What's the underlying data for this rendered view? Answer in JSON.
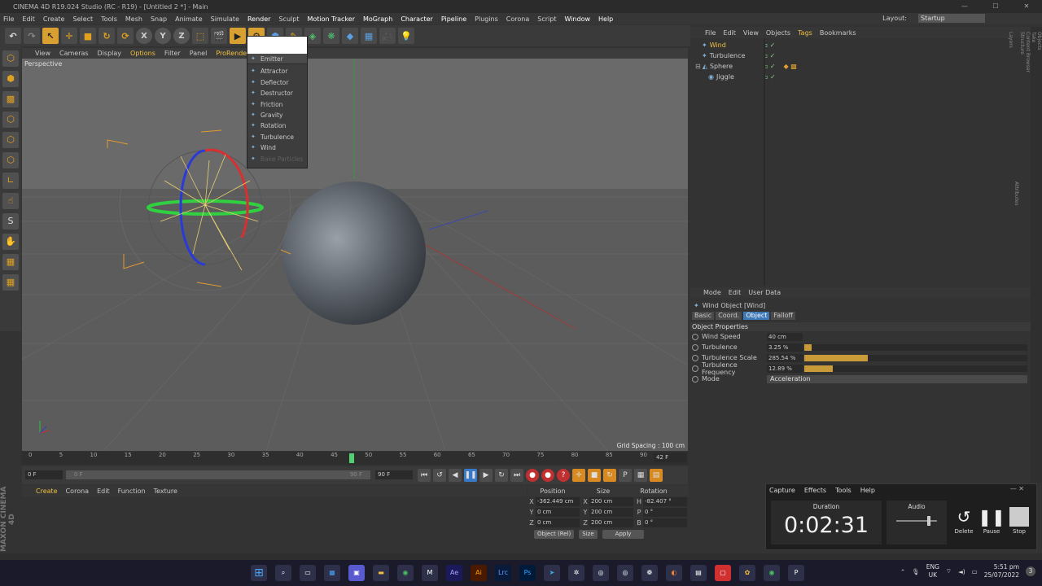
{
  "window": {
    "title": "CINEMA 4D R19.024 Studio (RC - R19) - [Untitled 2 *] - Main",
    "controls": [
      "—",
      "☐",
      "✕"
    ]
  },
  "menubar": {
    "items": [
      "File",
      "Edit",
      "Create",
      "Select",
      "Tools",
      "Mesh",
      "Snap",
      "Animate",
      "Simulate",
      "Render",
      "Sculpt",
      "Motion Tracker",
      "MoGraph",
      "Character",
      "Pipeline",
      "Plugins",
      "Corona",
      "Script",
      "Window",
      "Help"
    ],
    "highlighted": [
      "Render",
      "Motion Tracker",
      "MoGraph",
      "Character",
      "Pipeline",
      "Window",
      "Help"
    ],
    "layout_label": "Layout:",
    "layout_value": "Startup"
  },
  "toolbar": {
    "buttons": [
      "undo-icon",
      "redo-icon",
      "select-icon",
      "move-icon",
      "scale-icon",
      "rotate-icon",
      "live-select-icon",
      "x-axis",
      "y-axis",
      "z-axis",
      "coord-system-icon",
      "render-view-icon",
      "render-icon",
      "render-settings-icon",
      "cube-icon",
      "pen-icon",
      "subdivision-icon",
      "array-icon",
      "deformer-icon",
      "floor-icon",
      "camera-icon",
      "light-icon"
    ],
    "xyz": [
      "X",
      "Y",
      "Z"
    ]
  },
  "dropdown": {
    "items": [
      "Emitter",
      "Attractor",
      "Deflector",
      "Destructor",
      "Friction",
      "Gravity",
      "Rotation",
      "Turbulence",
      "Wind",
      "Bake Particles"
    ]
  },
  "viewport": {
    "menu": [
      "View",
      "Cameras",
      "Display",
      "Options",
      "Filter",
      "Panel",
      "ProRender"
    ],
    "highlighted": [
      "Options",
      "ProRender"
    ],
    "label": "Perspective",
    "grid_spacing": "Grid Spacing : 100 cm"
  },
  "timeline": {
    "ticks": [
      "0",
      "5",
      "10",
      "15",
      "20",
      "25",
      "30",
      "35",
      "40",
      "45",
      "50",
      "55",
      "60",
      "65",
      "70",
      "75",
      "80",
      "85",
      "90"
    ],
    "current_frame": "42 F",
    "start": "0 F",
    "min": "0 F",
    "max": "90 F",
    "end": "90 F"
  },
  "material_manager": {
    "menu": [
      "Create",
      "Corona",
      "Edit",
      "Function",
      "Texture"
    ]
  },
  "coordinates": {
    "headers": [
      "Position",
      "Size",
      "Rotation"
    ],
    "rows": [
      {
        "axis": "X",
        "pos": "-362.449 cm",
        "size_axis": "X",
        "size": "200 cm",
        "rot_axis": "H",
        "rot": "-82.407 °"
      },
      {
        "axis": "Y",
        "pos": "0 cm",
        "size_axis": "Y",
        "size": "200 cm",
        "rot_axis": "P",
        "rot": "0 °"
      },
      {
        "axis": "Z",
        "pos": "0 cm",
        "size_axis": "Z",
        "size": "200 cm",
        "rot_axis": "B",
        "rot": "0 °"
      }
    ],
    "mode": "Object (Rel)",
    "size_mode": "Size",
    "apply": "Apply"
  },
  "object_manager": {
    "menu": [
      "File",
      "Edit",
      "View",
      "Objects",
      "Tags",
      "Bookmarks"
    ],
    "objects": [
      {
        "name": "Wind",
        "selected": true
      },
      {
        "name": "Turbulence",
        "selected": false
      },
      {
        "name": "Sphere",
        "selected": false
      },
      {
        "name": "Jiggle",
        "selected": false
      }
    ]
  },
  "attribute_manager": {
    "menu": [
      "Mode",
      "Edit",
      "User Data"
    ],
    "title": "Wind Object [Wind]",
    "tabs": [
      "Basic",
      "Coord.",
      "Object",
      "Falloff"
    ],
    "active_tab": "Object",
    "section": "Object Properties",
    "properties": [
      {
        "label": "Wind Speed",
        "value": "40 cm",
        "fill": null
      },
      {
        "label": "Turbulence",
        "value": "3.25 %",
        "fill": 0.0325
      },
      {
        "label": "Turbulence Scale",
        "value": "285.54 %",
        "fill": 0.285
      },
      {
        "label": "Turbulence Frequency",
        "value": "12.89 %",
        "fill": 0.1289
      }
    ],
    "mode_label": "Mode",
    "mode_value": "Acceleration"
  },
  "right_strip": [
    "Objects",
    "Take",
    "Content Browser",
    "Structure",
    "Attributes",
    "Layers"
  ],
  "side_brand": "MAXON CINEMA 4D",
  "capture_widget": {
    "menu": [
      "Capture",
      "Effects",
      "Tools",
      "Help"
    ],
    "duration_label": "Duration",
    "duration": "0:02:31",
    "audio_label": "Audio",
    "buttons": [
      "Delete",
      "Pause",
      "Stop"
    ]
  },
  "taskbar": {
    "apps": [
      "windows-icon",
      "search-icon",
      "taskview-icon",
      "widgets-icon",
      "teams-icon",
      "explorer-icon",
      "chrome-icon",
      "maxon-icon",
      "Ae",
      "Ai",
      "Lrc",
      "Ps",
      "telegram-icon",
      "app-icon",
      "app-icon",
      "app-icon",
      "davinci-icon",
      "app-icon",
      "store-icon",
      "app-icon",
      "app-icon",
      "chrome-icon",
      "p-icon"
    ],
    "lang": "ENG",
    "region": "UK",
    "time": "5:51 pm",
    "date": "25/07/2022",
    "notif": "3"
  }
}
